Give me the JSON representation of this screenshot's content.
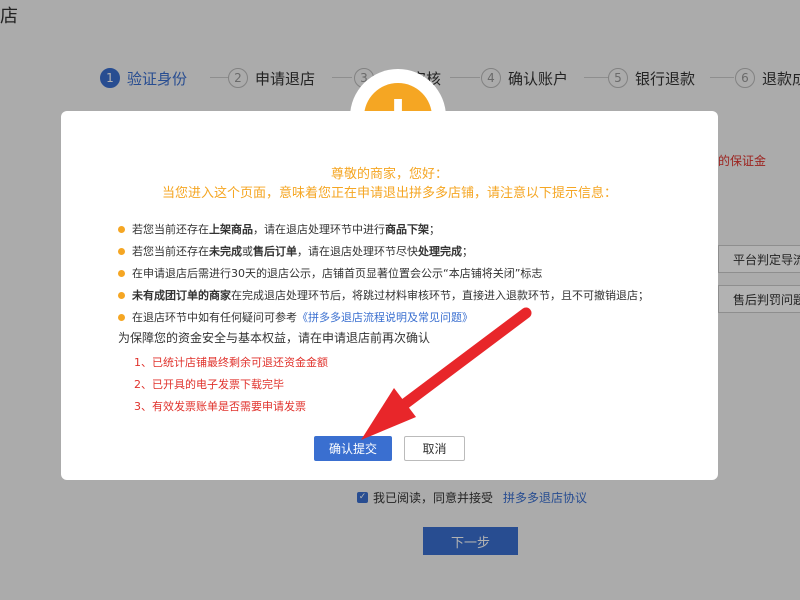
{
  "page": {
    "title": "店"
  },
  "steps": [
    {
      "num": "1",
      "label": "验证身份"
    },
    {
      "num": "2",
      "label": "申请退店"
    },
    {
      "num": "3",
      "label": "材料审核"
    },
    {
      "num": "4",
      "label": "确认账户"
    },
    {
      "num": "5",
      "label": "银行退款"
    },
    {
      "num": "6",
      "label": "退款成"
    }
  ],
  "background": {
    "deposit_note": "的保证金",
    "side_buttons": [
      "平台判定导流",
      "售后判罚问题"
    ],
    "agree_text": "我已阅读，同意并接受",
    "agree_link": "拼多多退店协议",
    "next_button": "下一步"
  },
  "modal": {
    "icon": "warning-icon",
    "greeting": "尊敬的商家，您好：",
    "intro": "当您进入这个页面，意味着您正在申请退出拼多多店铺，请注意以下提示信息：",
    "tips": [
      {
        "a": "若您当前还存在",
        "b": "上架商品",
        "c": "，请在退店处理环节中进行",
        "d": "商品下架",
        "e": "；"
      },
      {
        "a": "若您当前还存在",
        "b": "未完成",
        "c": "或",
        "d": "售后订单",
        "e": "，请在退店处理环节尽快",
        "f": "处理完成",
        "g": "；"
      },
      {
        "text": "在申请退店后需进行30天的退店公示，店铺首页显著位置会公示“本店铺将关闭”标志"
      },
      {
        "b": "未有成团订单的商家",
        "c": "在完成退店处理环节后，将跳过材料审核环节，直接进入退款环节，且不可撤销退店；"
      },
      {
        "a": "在退店环节中如有任何疑问可参考",
        "link": "《拼多多退店流程说明及常见问题》"
      }
    ],
    "reconfirm": "为保障您的资金安全与基本权益，请在申请退店前再次确认",
    "checks": [
      "1、已统计店铺最终剩余可退还资金金额",
      "2、已开具的电子发票下载完毕",
      "3、有效发票账单是否需要申请发票"
    ],
    "confirm_button": "确认提交",
    "cancel_button": "取消"
  },
  "colors": {
    "accent": "#3a6fd0",
    "warning": "#f5a623",
    "danger": "#e0322c",
    "arrow": "#e8262a"
  }
}
